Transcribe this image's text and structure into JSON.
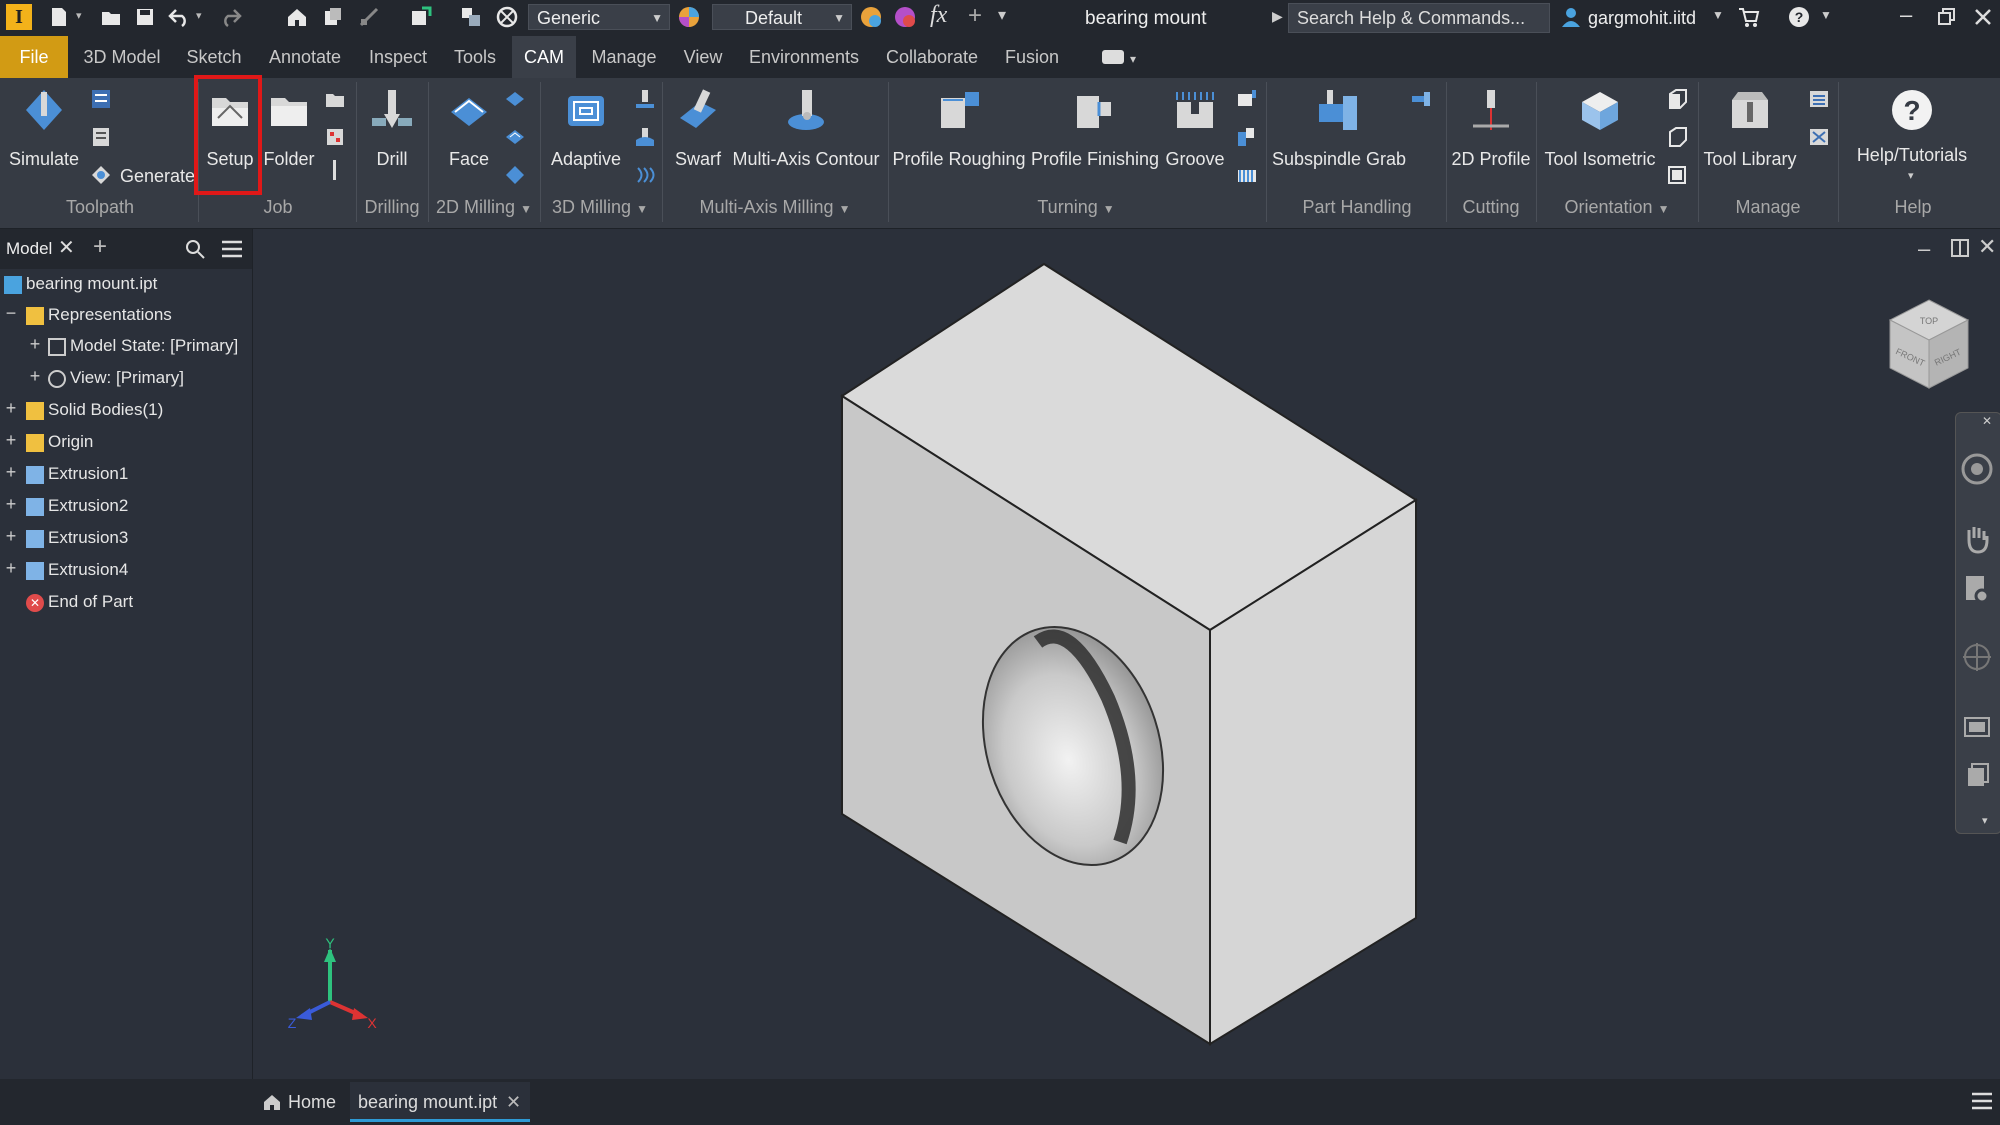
{
  "titlebar": {
    "app_logo": "I",
    "material_combo": "Generic",
    "appearance_combo": "Default",
    "document_title": "bearing mount",
    "search_placeholder": "Search Help & Commands...",
    "user_name": "gargmohit.iitd",
    "icons": [
      "new-icon",
      "open-icon",
      "save-icon",
      "undo-icon",
      "redo-icon",
      "home-icon",
      "project-icon",
      "measure-icon",
      "select-icon",
      "material-icon",
      "fx-icon",
      "cart-icon",
      "help-icon"
    ]
  },
  "menu": {
    "tabs": [
      "File",
      "3D Model",
      "Sketch",
      "Annotate",
      "Inspect",
      "Tools",
      "CAM",
      "Manage",
      "View",
      "Environments",
      "Collaborate",
      "Fusion"
    ],
    "active_tab": "CAM"
  },
  "ribbon": {
    "buttons": {
      "simulate": "Simulate",
      "generate": "Generate",
      "setup": "Setup",
      "folder": "Folder",
      "drill": "Drill",
      "face": "Face",
      "adaptive": "Adaptive",
      "swarf": "Swarf",
      "multi_axis_contour": "Multi-Axis Contour",
      "profile_roughing": "Profile Roughing",
      "profile_finishing": "Profile Finishing",
      "groove": "Groove",
      "subspindle_grab": "Subspindle Grab",
      "profile_2d": "2D Profile",
      "tool_isometric": "Tool Isometric",
      "tool_library": "Tool Library",
      "help_tutorials": "Help/Tutorials"
    },
    "groups": {
      "toolpath": "Toolpath",
      "job": "Job",
      "drilling": "Drilling",
      "milling_2d": "2D Milling",
      "milling_3d": "3D Milling",
      "multi_axis": "Multi-Axis Milling",
      "turning": "Turning",
      "part_handling": "Part Handling",
      "cutting": "Cutting",
      "orientation": "Orientation",
      "manage": "Manage",
      "help": "Help"
    }
  },
  "browser": {
    "tab_label": "Model",
    "tree": {
      "root": "bearing mount.ipt",
      "representations": "Representations",
      "model_state": "Model State: [Primary]",
      "view": "View: [Primary]",
      "solid_bodies": "Solid Bodies(1)",
      "origin": "Origin",
      "extrusion1": "Extrusion1",
      "extrusion2": "Extrusion2",
      "extrusion3": "Extrusion3",
      "extrusion4": "Extrusion4",
      "end_of_part": "End of Part"
    }
  },
  "viewport": {
    "axis_labels": {
      "x": "X",
      "y": "Y",
      "z": "Z"
    },
    "viewcube_faces": {
      "front": "FRONT",
      "right": "RIGHT",
      "top": "TOP"
    }
  },
  "bottom": {
    "home_tab": "Home",
    "doc_tab": "bearing mount.ipt"
  },
  "colors": {
    "accent_file": "#d29b14",
    "highlight_box": "#e01818",
    "active_tab_underline": "#2e9bd6"
  }
}
